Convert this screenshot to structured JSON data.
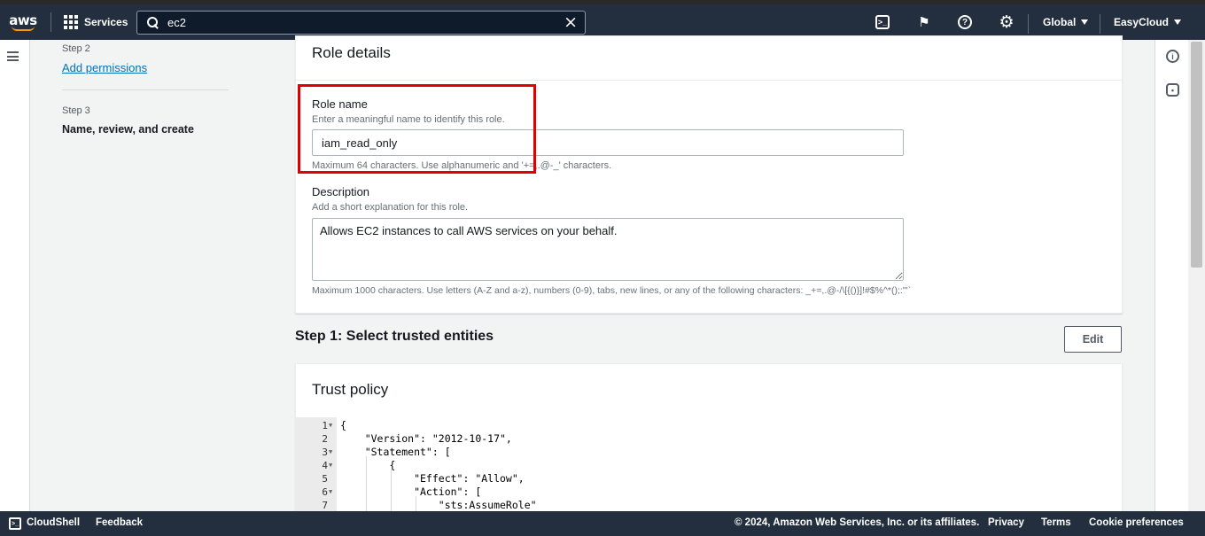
{
  "header": {
    "logo_text": "aws",
    "services_label": "Services",
    "search_value": "ec2",
    "clear_icon": "×",
    "region_label": "Global",
    "account_label": "EasyCloud"
  },
  "nav": {
    "step2_sub": "Step 2",
    "step2_link": "Add permissions",
    "step3_sub": "Step 3",
    "step3_label": "Name, review, and create"
  },
  "role_details": {
    "title": "Role details",
    "role_name_label": "Role name",
    "role_name_hint": "Enter a meaningful name to identify this role.",
    "role_name_value": "iam_read_only",
    "role_name_constraint": "Maximum 64 characters. Use alphanumeric and '+=,.@-_' characters.",
    "description_label": "Description",
    "description_hint": "Add a short explanation for this role.",
    "description_value": "Allows EC2 instances to call AWS services on your behalf.",
    "description_constraint": "Maximum 1000 characters. Use letters (A-Z and a-z), numbers (0-9), tabs, new lines, or any of the following characters: _+=,.@-/\\[{()}]!#$%^*();:\"'`"
  },
  "step1": {
    "heading": "Step 1: Select trusted entities",
    "edit_label": "Edit"
  },
  "trust_policy": {
    "title": "Trust policy",
    "line_numbers": [
      "1",
      "2",
      "3",
      "4",
      "5",
      "6",
      "7"
    ],
    "lines": [
      "{",
      "    \"Version\": \"2012-10-17\",",
      "    \"Statement\": [",
      "        {",
      "            \"Effect\": \"Allow\",",
      "            \"Action\": [",
      "                \"sts:AssumeRole\""
    ]
  },
  "footer": {
    "cloudshell": "CloudShell",
    "feedback": "Feedback",
    "copyright": "© 2024, Amazon Web Services, Inc. or its affiliates.",
    "privacy": "Privacy",
    "terms": "Terms",
    "cookies": "Cookie preferences"
  },
  "colors": {
    "topbar": "#232f3e",
    "link": "#0073bb",
    "accent": "#ff9900",
    "highlight": "#e00000"
  },
  "icons": [
    "aws-logo",
    "services-grid-icon",
    "search-icon",
    "clear-icon",
    "cloudshell-icon",
    "notifications-icon",
    "help-icon",
    "settings-icon",
    "caret-down-icon",
    "menu-icon",
    "info-icon",
    "security-icon"
  ]
}
